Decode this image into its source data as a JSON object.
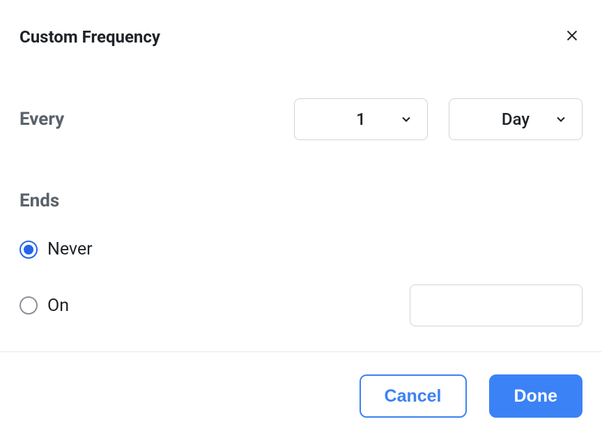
{
  "dialog": {
    "title": "Custom Frequency"
  },
  "every": {
    "label": "Every",
    "interval_value": "1",
    "unit_value": "Day"
  },
  "ends": {
    "label": "Ends",
    "options": {
      "never": "Never",
      "on": "On"
    },
    "selected": "never",
    "date_value": ""
  },
  "footer": {
    "cancel_label": "Cancel",
    "done_label": "Done"
  }
}
